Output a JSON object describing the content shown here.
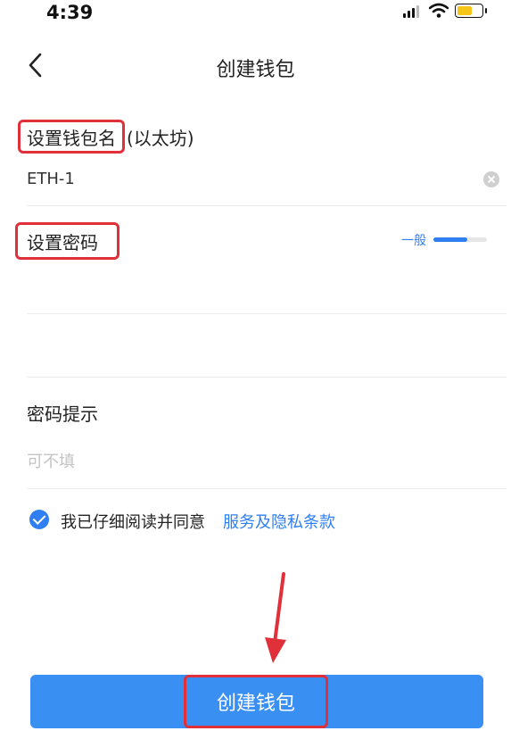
{
  "status_bar": {
    "time": "4:39"
  },
  "nav": {
    "title": "创建钱包"
  },
  "wallet_name": {
    "label": "设置钱包名",
    "suffix": "(以太坊)",
    "value": "ETH-1"
  },
  "password": {
    "label": "设置密码",
    "strength_label": "一般",
    "strength_fraction": 0.63
  },
  "hint": {
    "label": "密码提示",
    "placeholder": "可不填"
  },
  "agreement": {
    "checked": true,
    "text": "我已仔细阅读并同意",
    "link": "服务及隐私条款"
  },
  "submit": {
    "label": "创建钱包"
  },
  "colors": {
    "accent": "#2f7ff2",
    "button": "#3a8ff3",
    "highlight": "#e0303a"
  }
}
